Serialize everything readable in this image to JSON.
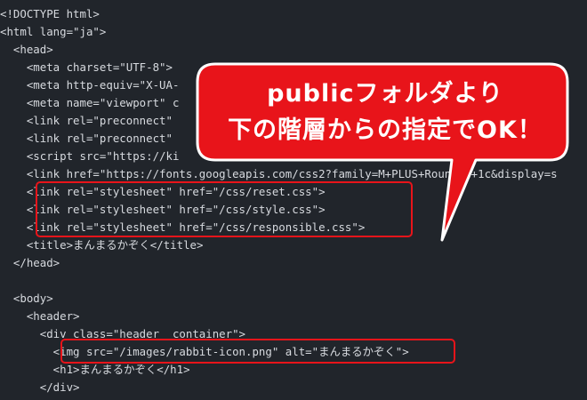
{
  "editor": {
    "lines": [
      "<!DOCTYPE html>",
      "<html lang=\"ja\">",
      "  <head>",
      "    <meta charset=\"UTF-8\">",
      "    <meta http-equiv=\"X-UA-",
      "    <meta name=\"viewport\" c",
      "    <link rel=\"preconnect\"",
      "    <link rel=\"preconnect\"",
      "    <script src=\"https://ki                                                    s\"",
      "    <link href=\"https://fonts.googleapis.com/css2?family=M+PLUS+Rounded+1c&display=s",
      "    <link rel=\"stylesheet\" href=\"/css/reset.css\">",
      "    <link rel=\"stylesheet\" href=\"/css/style.css\">",
      "    <link rel=\"stylesheet\" href=\"/css/responsible.css\">",
      "    <title>まんまるかぞく</title>",
      "  </head>",
      "",
      "  <body>",
      "    <header>",
      "      <div class=\"header  container\">",
      "        <img src=\"/images/rabbit-icon.png\" alt=\"まんまるかぞく\">",
      "        <h1>まんまるかぞく</h1>",
      "      </div>"
    ]
  },
  "callout": {
    "line1": "publicフォルダより",
    "line2": "下の階層からの指定でOK！",
    "fill_color": "#e8141a",
    "border_color": "#ffffff"
  },
  "highlight_color": "#e8141a"
}
